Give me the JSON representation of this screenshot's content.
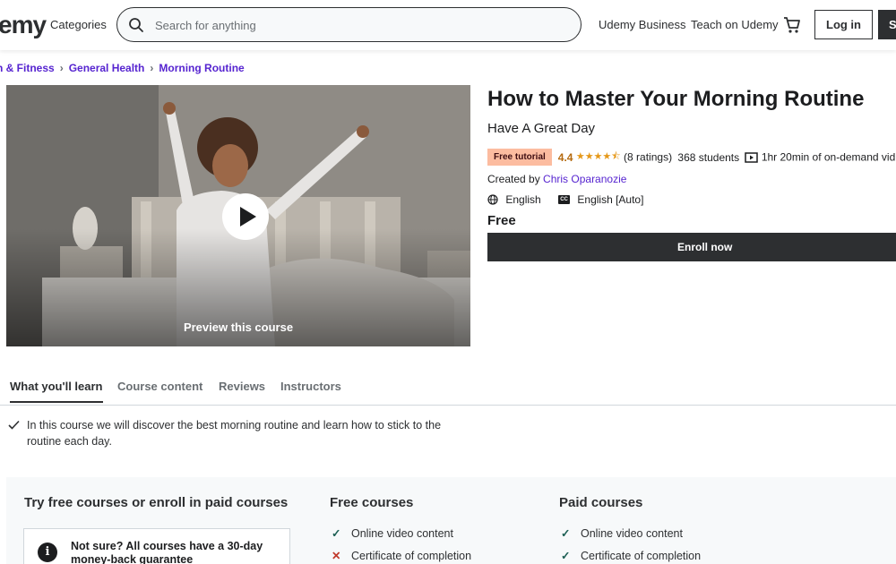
{
  "header": {
    "logo": "emy",
    "categories": "Categories",
    "search_placeholder": "Search for anything",
    "links": [
      "Udemy Business",
      "Teach on Udemy"
    ],
    "login": "Log in",
    "signup": "S"
  },
  "breadcrumb": [
    "n & Fitness",
    "General Health",
    "Morning Routine"
  ],
  "preview": {
    "label": "Preview this course"
  },
  "course": {
    "title": "How to Master Your Morning Routine",
    "subtitle": "Have A Great Day",
    "badge": "Free tutorial",
    "rating": "4.4",
    "stars": "★★★★⯪",
    "ratings_count": "(8 ratings)",
    "students": "368 students",
    "video": "1hr 20min of on-demand vid",
    "created_by_label": "Created by",
    "instructor": "Chris Oparanozie",
    "language": "English",
    "captions": "English [Auto]",
    "cc": "CC",
    "price": "Free",
    "enroll": "Enroll now"
  },
  "tabs": [
    "What you'll learn",
    "Course content",
    "Reviews",
    "Instructors"
  ],
  "learn": [
    "In this course we will discover the best morning routine and learn how to stick to the routine each day."
  ],
  "compare": {
    "title": "Try free courses or enroll in paid courses",
    "guarantee": "Not sure? All courses have a 30-day money-back guarantee",
    "info": "i",
    "free_title": "Free courses",
    "free_features": [
      {
        "mark": "✓",
        "label": "Online video content"
      },
      {
        "mark": "✕",
        "label": "Certificate of completion"
      }
    ],
    "paid_title": "Paid courses",
    "paid_features": [
      {
        "mark": "✓",
        "label": "Online video content"
      },
      {
        "mark": "✓",
        "label": "Certificate of completion"
      }
    ]
  },
  "colors": {
    "accent": "#5624d0",
    "badge": "#fcbca0",
    "star": "#e59819",
    "dark": "#2d2f31"
  }
}
